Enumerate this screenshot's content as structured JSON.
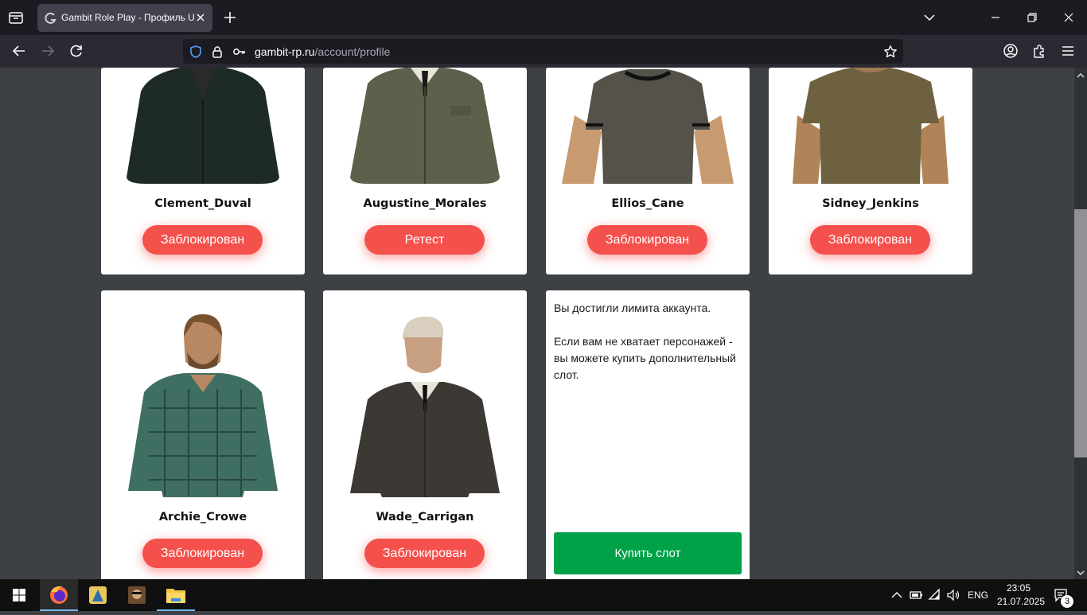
{
  "browser": {
    "tab_title": "Gambit Role Play - Профиль UC",
    "url_domain": "gambit-rp.ru",
    "url_path": "/account/profile"
  },
  "characters": [
    {
      "name": "Clement_Duval",
      "status": "Заблокирован",
      "skin_color": "#1e2a27"
    },
    {
      "name": "Augustine_Morales",
      "status": "Ретест",
      "skin_color": "#5f604b"
    },
    {
      "name": "Ellios_Cane",
      "status": "Заблокирован",
      "skin_color": "#55524a"
    },
    {
      "name": "Sidney_Jenkins",
      "status": "Заблокирован",
      "skin_color": "#6d6140"
    },
    {
      "name": "Archie_Crowe",
      "status": "Заблокирован",
      "skin_color": "#3f6f62"
    },
    {
      "name": "Wade_Carrigan",
      "status": "Заблокирован",
      "skin_color": "#3c3833"
    }
  ],
  "limit_card": {
    "line1": "Вы достигли лимита аккаунта.",
    "line2": "Если вам не хватает персонажей - вы можете купить дополнительный слот.",
    "buy_label": "Купить слот"
  },
  "taskbar": {
    "lang": "ENG",
    "time": "23:05",
    "date": "21.07.2025",
    "notifications": "3"
  },
  "colors": {
    "status_red": "#f4504c",
    "buy_green": "#00a249",
    "page_bg": "#3d4146"
  },
  "icons": [
    "tab-list-icon",
    "gambit-favicon",
    "close-icon",
    "plus-icon",
    "chevron-down-icon",
    "minimize-icon",
    "restore-icon",
    "back-icon",
    "forward-icon",
    "reload-icon",
    "shield-icon",
    "lock-icon",
    "key-icon",
    "star-icon",
    "account-icon",
    "extensions-icon",
    "menu-icon",
    "windows-start-icon",
    "firefox-icon",
    "game-icon",
    "avatar-app-icon",
    "folder-icon",
    "chevron-up-icon",
    "battery-icon",
    "wifi-icon",
    "volume-icon",
    "notification-icon"
  ]
}
